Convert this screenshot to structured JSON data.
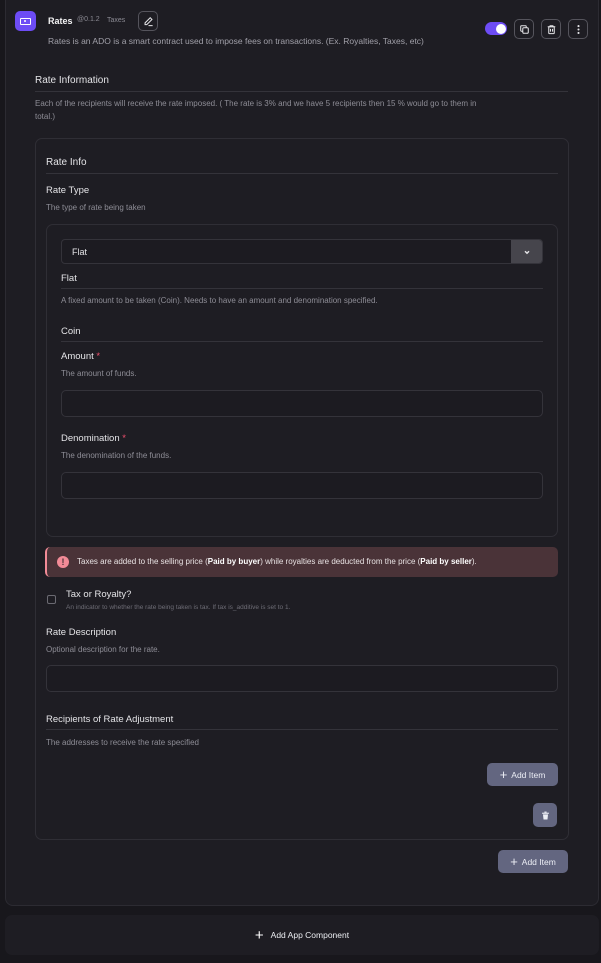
{
  "header": {
    "icon": "money-bill-icon",
    "title": "Rates",
    "version": "@0.1.2",
    "tag": "Taxes",
    "description": "Rates is an ADO is a smart contract used to impose fees on transactions. (Ex. Royalties, Taxes, etc)",
    "toggle_enabled": true,
    "actions": [
      "edit-icon",
      "copy-icon",
      "trash-icon",
      "more-vertical-icon"
    ]
  },
  "rate_information": {
    "title": "Rate Information",
    "description": "Each of the recipients will receive the rate imposed. ( The rate is 3% and we have 5 recipients then 15 % would go to them in",
    "description_cont": "total.)"
  },
  "rate_info": {
    "title": "Rate Info",
    "rate_type": {
      "label": "Rate Type",
      "help": "The type of rate being taken",
      "selected": "Flat",
      "option_title": "Flat",
      "option_help": "A fixed amount to be taken (Coin). Needs to have an amount and denomination specified.",
      "coin": {
        "title": "Coin",
        "amount": {
          "label": "Amount",
          "required_mark": "*",
          "help": "The amount of funds.",
          "value": "",
          "placeholder": ""
        },
        "denomination": {
          "label": "Denomination",
          "required_mark": "*",
          "help": "The denomination of the funds.",
          "value": "",
          "placeholder": ""
        }
      }
    },
    "alert": {
      "icon": "alert-circle-icon",
      "text_1": "Taxes are added to the selling price (",
      "bold_1": "Paid by buyer",
      "text_2": ") while royalties are deducted from the price (",
      "bold_2": "Paid by seller",
      "text_3": ")."
    },
    "tax_or_royalty": {
      "label": "Tax or Royalty?",
      "help": "An indicator to whether the rate being taken is tax. If tax is_additive is set to 1.",
      "checked": false
    },
    "rate_description": {
      "label": "Rate Description",
      "help": "Optional description for the rate.",
      "value": "",
      "placeholder": ""
    },
    "recipients": {
      "title": "Recipients of Rate Adjustment",
      "help": "The addresses to receive the rate specified",
      "add_item_label": "Add Item"
    }
  },
  "outer_add_item_label": "Add Item",
  "add_app_component_label": "Add App Component",
  "colors": {
    "accent": "#6d4cf5",
    "alert_bg": "#4a3338",
    "alert_icon": "#f28b97",
    "button_bg": "#636680",
    "required": "#f0506e"
  }
}
